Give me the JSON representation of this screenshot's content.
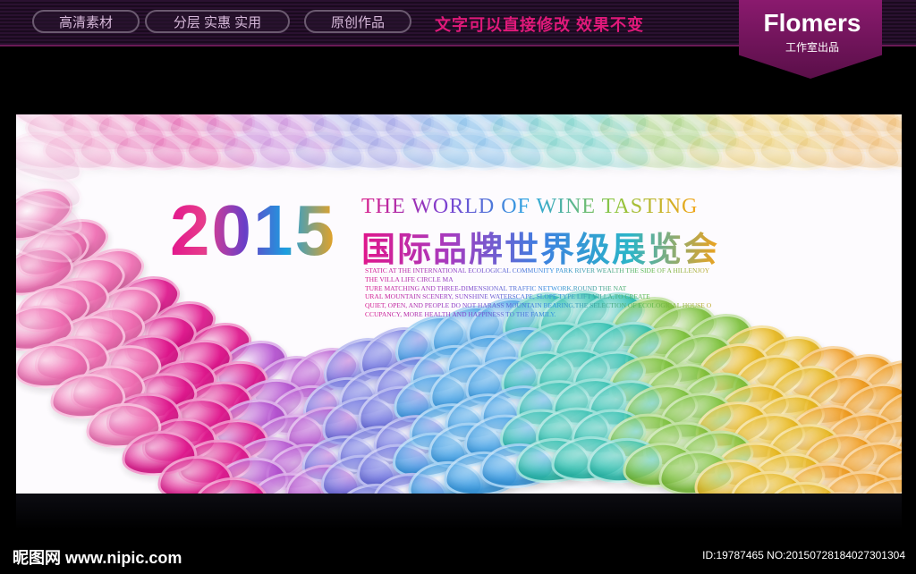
{
  "header": {
    "tags": [
      "高清素材",
      "分层 实惠 实用",
      "原创作品"
    ],
    "slogan": "文字可以直接修改  效果不变",
    "logo": {
      "name": "Flomers",
      "subtitle": "工作室出品"
    }
  },
  "banner": {
    "year": "2015",
    "title_en": "THE WORLD OF WINE TASTING",
    "title_cn": "国际品牌世界级展览会",
    "description": [
      "STATIC AT THE INTERNATIONAL ECOLOGICAL COMMUNITY PARK RIVER WEALTH THE SIDE OF A HILLENJOY",
      "THE VILLA LIFE CIRCLE MA",
      "TURE MATCHING AND THREE-DIMENSIONAL TRAFFIC NETWORK,ROUND THE NAT",
      "URAL MOUNTAIN SCENERY, SUNSHINE WATERSCAPE, SLOPE TYPE LIFT VILLA,TO CREATE",
      "QUIET, OPEN, AND PEOPLE DO NOT HARASS MOUNTAIN BEARING,THE SELECTION OF ECOLOGICAL HOUSE O",
      "CCUPANCY, MORE HEALTH AND HAPPINESS TO THE FAMILY."
    ]
  },
  "footer": {
    "site": "昵图网 www.nipic.com",
    "id_text": "ID:19787465 NO:20150728184027301304"
  },
  "colors": {
    "accent_magenta": "#e0197a",
    "logo_bg": "#7a1760",
    "petal_palette": [
      "#f06cb2",
      "#e0168d",
      "#b44fd0",
      "#6a6fe0",
      "#3c9ee6",
      "#2cc0b0",
      "#7cc23a",
      "#e8b81c",
      "#f09a1a"
    ]
  }
}
